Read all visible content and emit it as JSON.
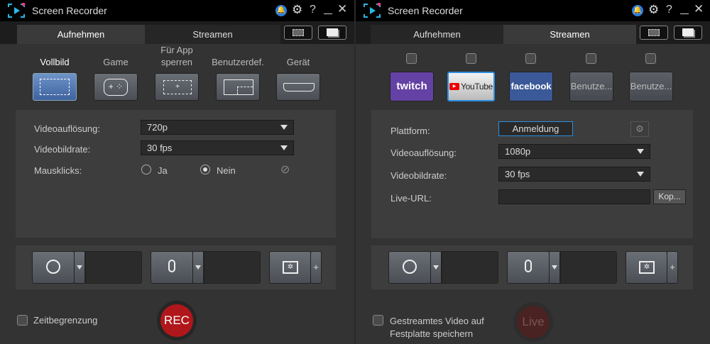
{
  "left": {
    "title": "Screen Recorder",
    "tabs": [
      "Aufnehmen",
      "Streamen"
    ],
    "modes": [
      {
        "label": "Vollbild"
      },
      {
        "label": "Game"
      },
      {
        "label": "Für App sperren"
      },
      {
        "label": "Benutzerdef."
      },
      {
        "label": "Gerät"
      }
    ],
    "settings": {
      "resolution_label": "Videoauflösung:",
      "resolution": "720p",
      "framerate_label": "Videobildrate:",
      "framerate": "30 fps",
      "mouse_label": "Mausklicks:",
      "mouse_yes": "Ja",
      "mouse_no": "Nein",
      "mouse_selected": "Nein"
    },
    "time_limit": "Zeitbegrenzung",
    "rec": "REC"
  },
  "right": {
    "title": "Screen Recorder",
    "tabs": [
      "Aufnehmen",
      "Streamen"
    ],
    "platforms": [
      "twitch",
      "YouTube",
      "facebook",
      "Benutze...",
      "Benutze..."
    ],
    "selected_platform": "YouTube",
    "settings": {
      "platform_label": "Plattform:",
      "login": "Anmeldung",
      "resolution_label": "Videoauflösung:",
      "resolution": "1080p",
      "framerate_label": "Videobildrate:",
      "framerate": "30 fps",
      "url_label": "Live-URL:",
      "url": "",
      "copy": "Kop..."
    },
    "save_label": "Gestreamtes Video auf Festplatte speichern",
    "live": "Live"
  },
  "colors": {
    "rec": "#b0171b",
    "accent": "#2d7de0",
    "twitch": "#6441a4",
    "facebook": "#3b5998"
  }
}
